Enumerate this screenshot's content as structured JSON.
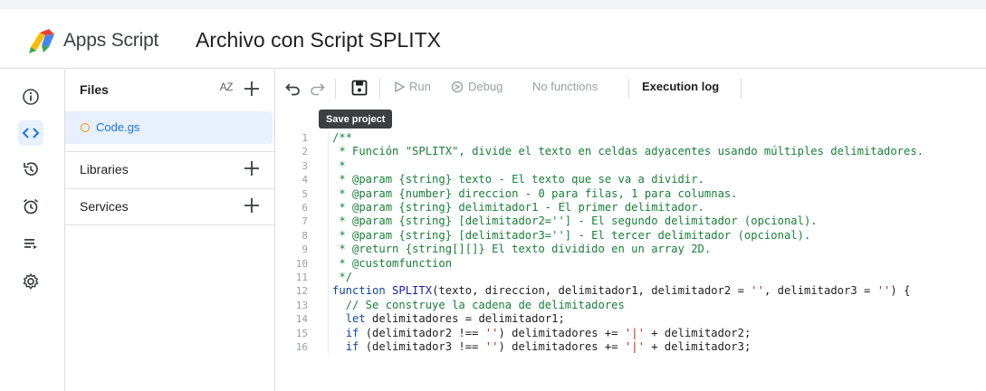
{
  "header": {
    "app_name": "Apps Script",
    "project_title": "Archivo con Script SPLITX"
  },
  "rail": {
    "items": [
      {
        "name": "overview",
        "icon": "info-icon"
      },
      {
        "name": "editor",
        "icon": "code-icon",
        "active": true
      },
      {
        "name": "executions",
        "icon": "history-icon"
      },
      {
        "name": "triggers",
        "icon": "alarm-icon"
      },
      {
        "name": "executions-list",
        "icon": "playlist-icon"
      },
      {
        "name": "settings",
        "icon": "gear-icon"
      }
    ]
  },
  "files_panel": {
    "files_label": "Files",
    "sort_label": "AZ",
    "file_name": "Code.gs",
    "libraries_label": "Libraries",
    "services_label": "Services"
  },
  "toolbar": {
    "run_label": "Run",
    "debug_label": "Debug",
    "functions_label": "No functions",
    "execution_log_label": "Execution log",
    "save_tooltip": "Save project"
  },
  "code": {
    "lines": [
      {
        "n": "1",
        "text": "/**"
      },
      {
        "n": "2",
        "text": " * Función \"SPLITX\", divide el texto en celdas adyacentes usando múltiples delimitadores."
      },
      {
        "n": "3",
        "text": " *"
      },
      {
        "n": "4",
        "text": " * @param {string} texto - El texto que se va a dividir."
      },
      {
        "n": "5",
        "text": " * @param {number} direccion - 0 para filas, 1 para columnas."
      },
      {
        "n": "6",
        "text": " * @param {string} delimitador1 - El primer delimitador."
      },
      {
        "n": "7",
        "text": " * @param {string} [delimitador2=''] - El segundo delimitador (opcional)."
      },
      {
        "n": "8",
        "text": " * @param {string} [delimitador3=''] - El tercer delimitador (opcional)."
      },
      {
        "n": "9",
        "text": " * @return {string[][]} El texto dividido en un array 2D."
      },
      {
        "n": "10",
        "text": " * @customfunction"
      },
      {
        "n": "11",
        "text": " */"
      },
      {
        "n": "12",
        "text": "function SPLITX(texto, direccion, delimitador1, delimitador2 = '', delimitador3 = '') {"
      },
      {
        "n": "13",
        "text": "  // Se construye la cadena de delimitadores"
      },
      {
        "n": "14",
        "text": "  let delimitadores = delimitador1;"
      },
      {
        "n": "15",
        "text": "  if (delimitador2 !== '') delimitadores += '|' + delimitador2;"
      },
      {
        "n": "16",
        "text": "  if (delimitador3 !== '') delimitadores += '|' + delimitador3;"
      }
    ]
  },
  "colors": {
    "accent": "#1a73e8",
    "comment": "#188038",
    "string": "#c5221f",
    "keyword": "#1a1aa6"
  }
}
